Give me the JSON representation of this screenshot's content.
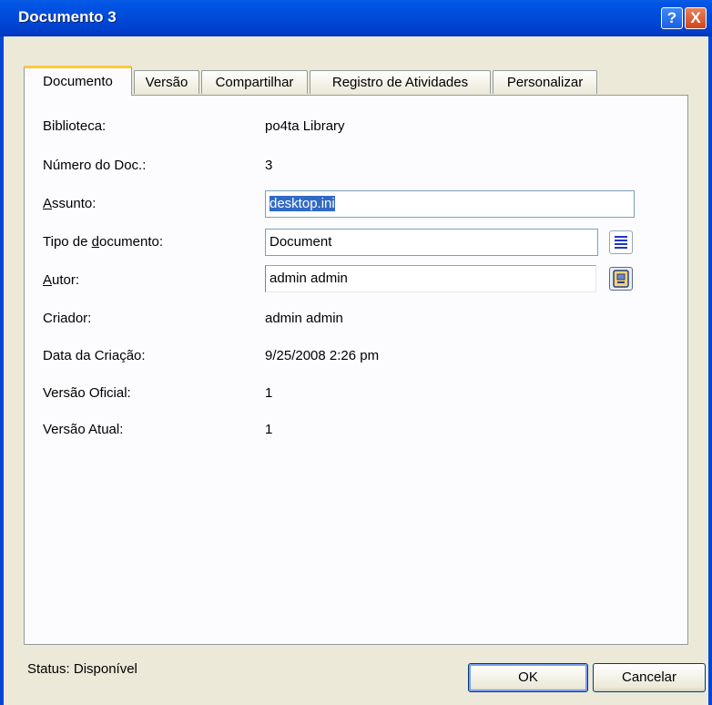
{
  "window": {
    "title": "Documento 3",
    "help_label": "?",
    "close_label": "X"
  },
  "tabs": [
    {
      "label": "Documento",
      "active": true
    },
    {
      "label": "Versão",
      "active": false
    },
    {
      "label": "Compartilhar",
      "active": false
    },
    {
      "label": "Registro de Atividades",
      "active": false
    },
    {
      "label": "Personalizar",
      "active": false
    }
  ],
  "fields": {
    "biblioteca": {
      "label": "Biblioteca:",
      "value": "po4ta Library"
    },
    "numero_doc": {
      "label": "Número do Doc.:",
      "value": "3"
    },
    "assunto": {
      "label_prefix": "",
      "label_hotkey": "A",
      "label_rest": "ssunto:",
      "value": "desktop.ini"
    },
    "tipo_documento": {
      "label_prefix": "Tipo de ",
      "label_hotkey": "d",
      "label_rest": "ocumento:",
      "value": "Document"
    },
    "autor": {
      "label_prefix": "",
      "label_hotkey": "A",
      "label_rest": "utor:",
      "value": "admin admin"
    },
    "criador": {
      "label": "Criador:",
      "value": "admin admin"
    },
    "data_criacao": {
      "label": "Data da Criação:",
      "value": "9/25/2008 2:26 pm"
    },
    "versao_oficial": {
      "label": "Versão Oficial:",
      "value": "1"
    },
    "versao_atual": {
      "label": "Versão Atual:",
      "value": "1"
    }
  },
  "icons": {
    "doc_type_button": "list-icon",
    "author_button": "address-book-icon"
  },
  "status": {
    "text": "Status: Disponível"
  },
  "buttons": {
    "ok": "OK",
    "cancel": "Cancelar"
  },
  "colors": {
    "titlebar": "#0047d6",
    "selection": "#316ac5",
    "dialog_bg": "#ece9d8",
    "active_tab_accent": "#ffc83c"
  }
}
